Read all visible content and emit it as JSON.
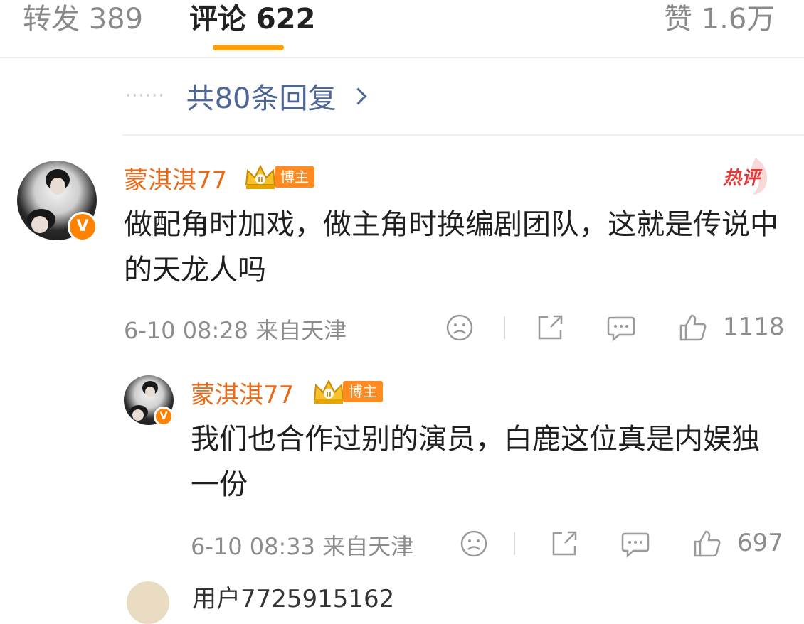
{
  "tabs": {
    "repost": "转发 389",
    "comments": "评论 622",
    "likes": "赞 1.6万"
  },
  "replies_link": {
    "dots": "······",
    "label": "共80条回复"
  },
  "comments": [
    {
      "username": "蒙淇淇77",
      "tag": "博主",
      "hot_label": "热评",
      "text": "做配角时加戏，做主角时换编剧团队，这就是传说中的天龙人吗",
      "meta": "6-10 08:28 来自天津",
      "like_count": "1118"
    },
    {
      "username": "蒙淇淇77",
      "tag": "博主",
      "text": "我们也合作过别的演员，白鹿这位真是内娱独一份",
      "meta": "6-10 08:33 来自天津",
      "like_count": "697"
    }
  ],
  "peek_username": "用户7725915162",
  "colors": {
    "accent": "#ff9f0a",
    "username": "#e86b1a",
    "link": "#4f6796",
    "hot": "#e33b3b"
  }
}
